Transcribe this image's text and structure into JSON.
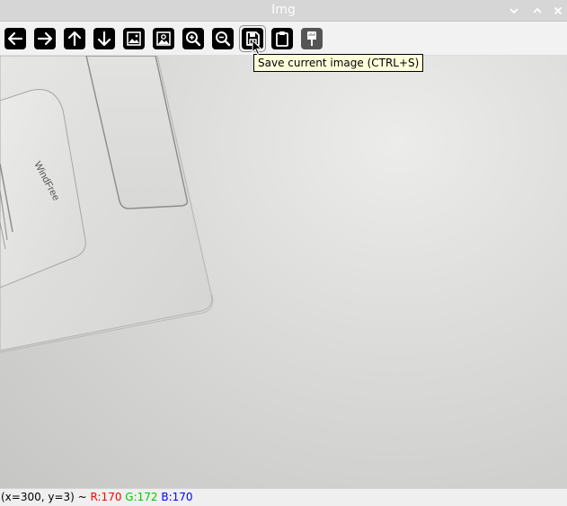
{
  "window": {
    "title": "Img"
  },
  "toolbar": {
    "buttons": [
      {
        "name": "pan-left-button",
        "icon": "arrow-left-icon"
      },
      {
        "name": "pan-right-button",
        "icon": "arrow-right-icon"
      },
      {
        "name": "pan-up-button",
        "icon": "arrow-up-icon"
      },
      {
        "name": "pan-down-button",
        "icon": "arrow-down-icon"
      },
      {
        "name": "zoom-original-button",
        "icon": "image-icon"
      },
      {
        "name": "zoom-fit-button",
        "icon": "image-fit-icon"
      },
      {
        "name": "zoom-in-button",
        "icon": "zoom-in-icon"
      },
      {
        "name": "zoom-out-button",
        "icon": "zoom-out-icon"
      },
      {
        "name": "save-image-button",
        "icon": "save-icon"
      },
      {
        "name": "copy-clipboard-button",
        "icon": "clipboard-icon"
      },
      {
        "name": "properties-button",
        "icon": "paint-brush-icon"
      }
    ],
    "tooltip": "Save current image (CTRL+S)"
  },
  "statusbar": {
    "coords": "(x=300, y=3) ~",
    "r": "R:170",
    "g": "G:172",
    "b": "B:170"
  },
  "image": {
    "embossed_text": "WindFree"
  },
  "colors": {
    "titlebar": "#d6d6d6",
    "tooltip_bg": "#ffffdc",
    "red": "#ff0000",
    "green": "#00cc00",
    "blue": "#0000ff"
  }
}
